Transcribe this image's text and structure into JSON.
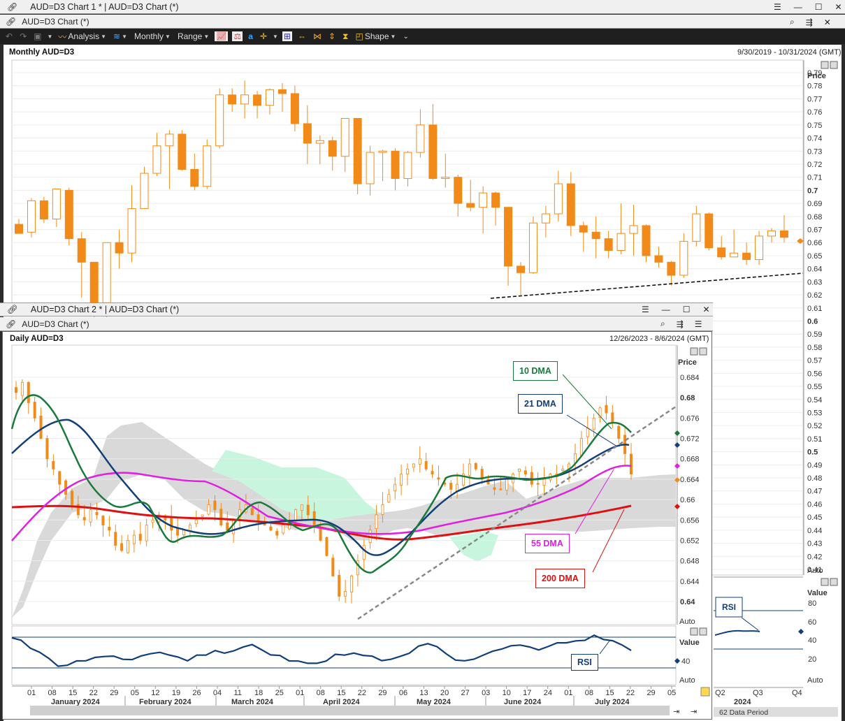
{
  "window1": {
    "title": "AUD=D3 Chart 1 * | AUD=D3 Chart (*)",
    "tab": "AUD=D3 Chart (*)"
  },
  "toolbar": {
    "analysis": "Analysis",
    "interval": "Monthly",
    "range": "Range",
    "shape": "Shape"
  },
  "chart1": {
    "header_left": "Monthly AUD=D3",
    "header_right": "9/30/2019 - 10/31/2024 (GMT)",
    "price_label": "Price",
    "y_ticks": [
      "0.79",
      "0.78",
      "0.77",
      "0.76",
      "0.75",
      "0.74",
      "0.73",
      "0.72",
      "0.71",
      "0.7",
      "0.69",
      "0.68",
      "0.67",
      "0.66",
      "0.65",
      "0.64",
      "0.63",
      "0.62",
      "0.61",
      "0.6",
      "0.59",
      "0.58",
      "0.57",
      "0.56",
      "0.55",
      "0.54",
      "0.53",
      "0.52",
      "0.51",
      "0.5",
      "0.49",
      "0.48",
      "0.47",
      "0.46",
      "0.45",
      "0.44",
      "0.43",
      "0.42",
      "0.41"
    ],
    "auto": "Auto",
    "rsi_value_label": "Value",
    "rsi_ticks": [
      "80",
      "60",
      "40",
      "20"
    ],
    "rsi_auto": "Auto",
    "rsi_label": "RSI",
    "x_labels": [
      "Q2",
      "Q3",
      "Q4"
    ],
    "x_year": "2024",
    "data_period": "62 Data Period"
  },
  "window2": {
    "title": "AUD=D3 Chart 2 * | AUD=D3 Chart (*)",
    "tab": "AUD=D3 Chart (*)"
  },
  "chart2": {
    "header_left": "Daily AUD=D3",
    "header_right": "12/26/2023 - 8/6/2024 (GMT)",
    "price_label": "Price",
    "auto": "Auto",
    "rsi_value_label": "Value",
    "rsi_tick": "40",
    "rsi_auto": "Auto",
    "rsi_label": "RSI",
    "labels": {
      "dma10": "10 DMA",
      "dma21": "21 DMA",
      "dma55": "55 DMA",
      "dma200": "200 DMA"
    },
    "x_day_labels": [
      "01",
      "08",
      "15",
      "22",
      "29",
      "05",
      "12",
      "19",
      "26",
      "04",
      "11",
      "18",
      "25",
      "01",
      "08",
      "15",
      "22",
      "29",
      "06",
      "13",
      "20",
      "27",
      "03",
      "10",
      "17",
      "24",
      "01",
      "08",
      "15",
      "22",
      "29",
      "05"
    ],
    "x_month_labels": [
      "January 2024",
      "February 2024",
      "March 2024",
      "April 2024",
      "May 2024",
      "June 2024",
      "July 2024"
    ]
  },
  "chart_data": [
    {
      "type": "candlestick",
      "title": "Monthly AUD=D3",
      "ylabel": "Price",
      "ylim": [
        0.405,
        0.795
      ],
      "ohlc": [
        [
          0.674,
          0.678,
          0.667,
          0.667
        ],
        [
          0.668,
          0.694,
          0.664,
          0.692
        ],
        [
          0.692,
          0.695,
          0.675,
          0.678
        ],
        [
          0.678,
          0.699,
          0.672,
          0.701
        ],
        [
          0.7,
          0.702,
          0.658,
          0.663
        ],
        [
          0.663,
          0.668,
          0.618,
          0.645
        ],
        [
          0.645,
          0.644,
          0.55,
          0.614
        ],
        [
          0.614,
          0.66,
          0.598,
          0.66
        ],
        [
          0.66,
          0.67,
          0.64,
          0.652
        ],
        [
          0.652,
          0.704,
          0.645,
          0.686
        ],
        [
          0.686,
          0.718,
          0.687,
          0.713
        ],
        [
          0.713,
          0.744,
          0.711,
          0.734
        ],
        [
          0.734,
          0.746,
          0.701,
          0.743
        ],
        [
          0.743,
          0.746,
          0.715,
          0.716
        ],
        [
          0.716,
          0.728,
          0.7,
          0.703
        ],
        [
          0.703,
          0.739,
          0.701,
          0.734
        ],
        [
          0.734,
          0.778,
          0.732,
          0.773
        ],
        [
          0.773,
          0.778,
          0.76,
          0.766
        ],
        [
          0.766,
          0.784,
          0.755,
          0.773
        ],
        [
          0.773,
          0.776,
          0.755,
          0.765
        ],
        [
          0.765,
          0.778,
          0.758,
          0.777
        ],
        [
          0.777,
          0.782,
          0.76,
          0.774
        ],
        [
          0.774,
          0.78,
          0.745,
          0.751
        ],
        [
          0.751,
          0.765,
          0.72,
          0.736
        ],
        [
          0.736,
          0.742,
          0.72,
          0.738
        ],
        [
          0.738,
          0.741,
          0.715,
          0.726
        ],
        [
          0.726,
          0.752,
          0.714,
          0.755
        ],
        [
          0.755,
          0.752,
          0.697,
          0.705
        ],
        [
          0.705,
          0.734,
          0.696,
          0.729
        ],
        [
          0.729,
          0.731,
          0.707,
          0.73
        ],
        [
          0.73,
          0.732,
          0.7,
          0.709
        ],
        [
          0.709,
          0.73,
          0.703,
          0.729
        ],
        [
          0.729,
          0.762,
          0.725,
          0.75
        ],
        [
          0.75,
          0.766,
          0.708,
          0.709
        ],
        [
          0.709,
          0.728,
          0.702,
          0.71
        ],
        [
          0.71,
          0.712,
          0.68,
          0.69
        ],
        [
          0.69,
          0.708,
          0.684,
          0.687
        ],
        [
          0.687,
          0.703,
          0.667,
          0.698
        ],
        [
          0.698,
          0.699,
          0.673,
          0.687
        ],
        [
          0.687,
          0.686,
          0.627,
          0.642
        ],
        [
          0.642,
          0.645,
          0.62,
          0.637
        ],
        [
          0.637,
          0.68,
          0.636,
          0.675
        ],
        [
          0.675,
          0.688,
          0.664,
          0.682
        ],
        [
          0.682,
          0.715,
          0.676,
          0.705
        ],
        [
          0.705,
          0.714,
          0.665,
          0.673
        ],
        [
          0.673,
          0.676,
          0.653,
          0.668
        ],
        [
          0.668,
          0.68,
          0.648,
          0.663
        ],
        [
          0.663,
          0.669,
          0.648,
          0.654
        ],
        [
          0.654,
          0.69,
          0.651,
          0.667
        ],
        [
          0.667,
          0.689,
          0.65,
          0.673
        ],
        [
          0.673,
          0.674,
          0.645,
          0.65
        ],
        [
          0.65,
          0.657,
          0.641,
          0.645
        ],
        [
          0.645,
          0.646,
          0.627,
          0.635
        ],
        [
          0.635,
          0.667,
          0.633,
          0.661
        ],
        [
          0.661,
          0.688,
          0.657,
          0.682
        ],
        [
          0.682,
          0.683,
          0.654,
          0.656
        ],
        [
          0.656,
          0.665,
          0.647,
          0.649
        ],
        [
          0.649,
          0.67,
          0.649,
          0.652
        ],
        [
          0.652,
          0.66,
          0.643,
          0.647
        ],
        [
          0.647,
          0.669,
          0.643,
          0.665
        ],
        [
          0.665,
          0.671,
          0.66,
          0.669
        ],
        [
          0.669,
          0.681,
          0.66,
          0.664
        ]
      ]
    },
    {
      "type": "line",
      "title": "Daily AUD=D3",
      "ylabel": "Price",
      "ylim": [
        0.6375,
        0.6875
      ],
      "series": [
        {
          "name": "10 DMA",
          "color": "#1a7a3c"
        },
        {
          "name": "21 DMA",
          "color": "#123f78"
        },
        {
          "name": "55 DMA",
          "color": "#e020e0"
        },
        {
          "name": "200 DMA",
          "color": "#dd1111"
        }
      ]
    }
  ],
  "colors": {
    "up_candle": "#ffffff",
    "down_candle": "#f28a19",
    "candle_edge": "#f28a19",
    "dma10": "#1a7a3c",
    "dma21": "#123f78",
    "dma55": "#e020e0",
    "dma200": "#dd1111",
    "rsi": "#123f78"
  }
}
